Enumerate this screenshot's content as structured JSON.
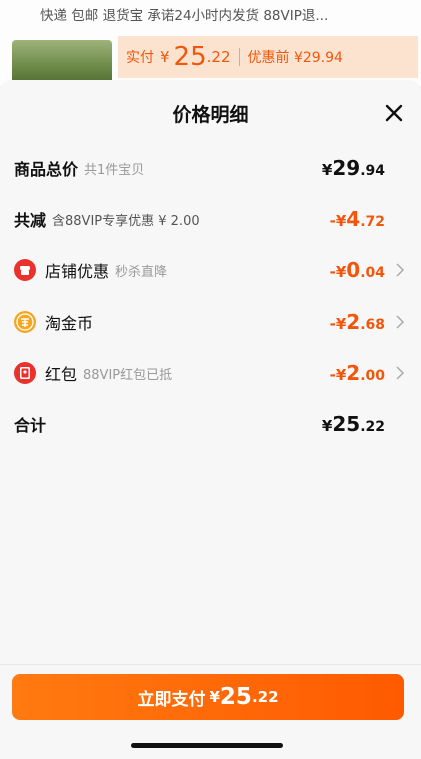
{
  "background": {
    "services": "快递 包邮 退货宝 承诺24小时内发货 88VIP退...",
    "price_label": "实付",
    "price_symbol": "¥",
    "price_int": "25",
    "price_dec": ".22",
    "price_before": "优惠前 ¥29.94"
  },
  "sheet": {
    "title": "价格明细",
    "rows": [
      {
        "label": "商品总价",
        "sub": "共1件宝贝",
        "sym": "¥",
        "int": "29",
        "dec": ".94"
      },
      {
        "label": "共减",
        "sub": "含88VIP专享优惠 ¥ 2.00",
        "sym": "-¥",
        "int": "4",
        "dec": ".72"
      },
      {
        "label": "店铺优惠",
        "sub": "秒杀直降",
        "sym": "-¥",
        "int": "0",
        "dec": ".04",
        "icon": "shop-coupon-icon"
      },
      {
        "label": "淘金币",
        "sub": "",
        "sym": "-¥",
        "int": "2",
        "dec": ".68",
        "icon": "taojinbi-coin-icon"
      },
      {
        "label": "红包",
        "sub": "88VIP红包已抵",
        "sym": "-¥",
        "int": "2",
        "dec": ".00",
        "icon": "red-packet-icon"
      },
      {
        "label": "合计",
        "sub": "",
        "sym": "¥",
        "int": "25",
        "dec": ".22"
      }
    ]
  },
  "pay_button": {
    "label": "立即支付",
    "sym": "¥",
    "int": "25",
    "dec": ".22"
  },
  "colors": {
    "accent": "#f2560c",
    "button": "#ff6a00",
    "coin": "#f5a623",
    "red": "#e8322b"
  }
}
